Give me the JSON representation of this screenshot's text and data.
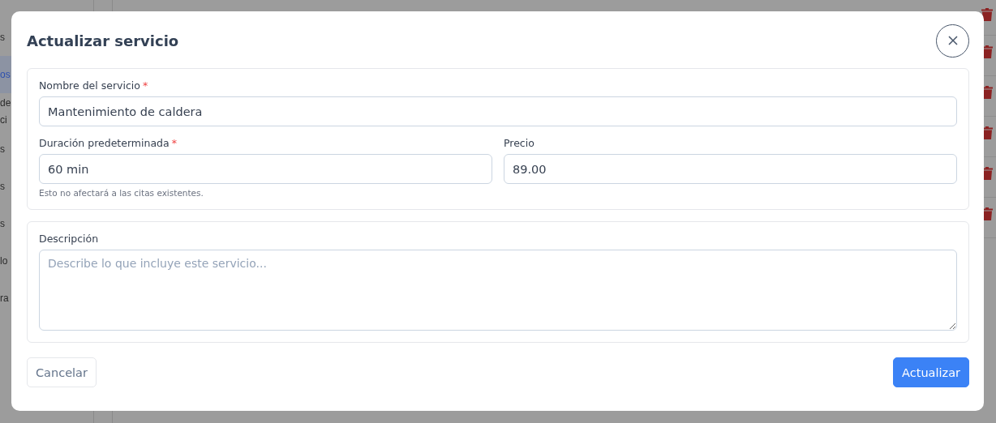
{
  "sidebar": {
    "items": [
      {
        "label": "s",
        "selected": false
      },
      {
        "label": "os",
        "selected": true
      },
      {
        "label": "de\nci",
        "selected": false
      },
      {
        "label": "s",
        "selected": false
      },
      {
        "label": "s",
        "selected": false
      },
      {
        "label": "s",
        "selected": false
      },
      {
        "label": "lo",
        "selected": false
      },
      {
        "label": "ra",
        "selected": false
      }
    ]
  },
  "dialog": {
    "title": "Actualizar servicio",
    "fields": [
      {
        "label": "Nombre del servicio",
        "required_mark": "*",
        "value": "Mantenimiento de caldera"
      },
      {
        "label": "Duración predeterminada",
        "required_mark": "*",
        "value": "60 min",
        "hint": "Esto no afectará a las citas existentes."
      },
      {
        "label": "Precio",
        "value": "89.00"
      }
    ],
    "description": {
      "label": "Descripción",
      "placeholder": "Describe lo que incluye este servicio..."
    },
    "buttons": [
      {
        "label": "Cancelar",
        "kind": "secondary"
      },
      {
        "label": "Actualizar",
        "kind": "primary"
      }
    ]
  }
}
